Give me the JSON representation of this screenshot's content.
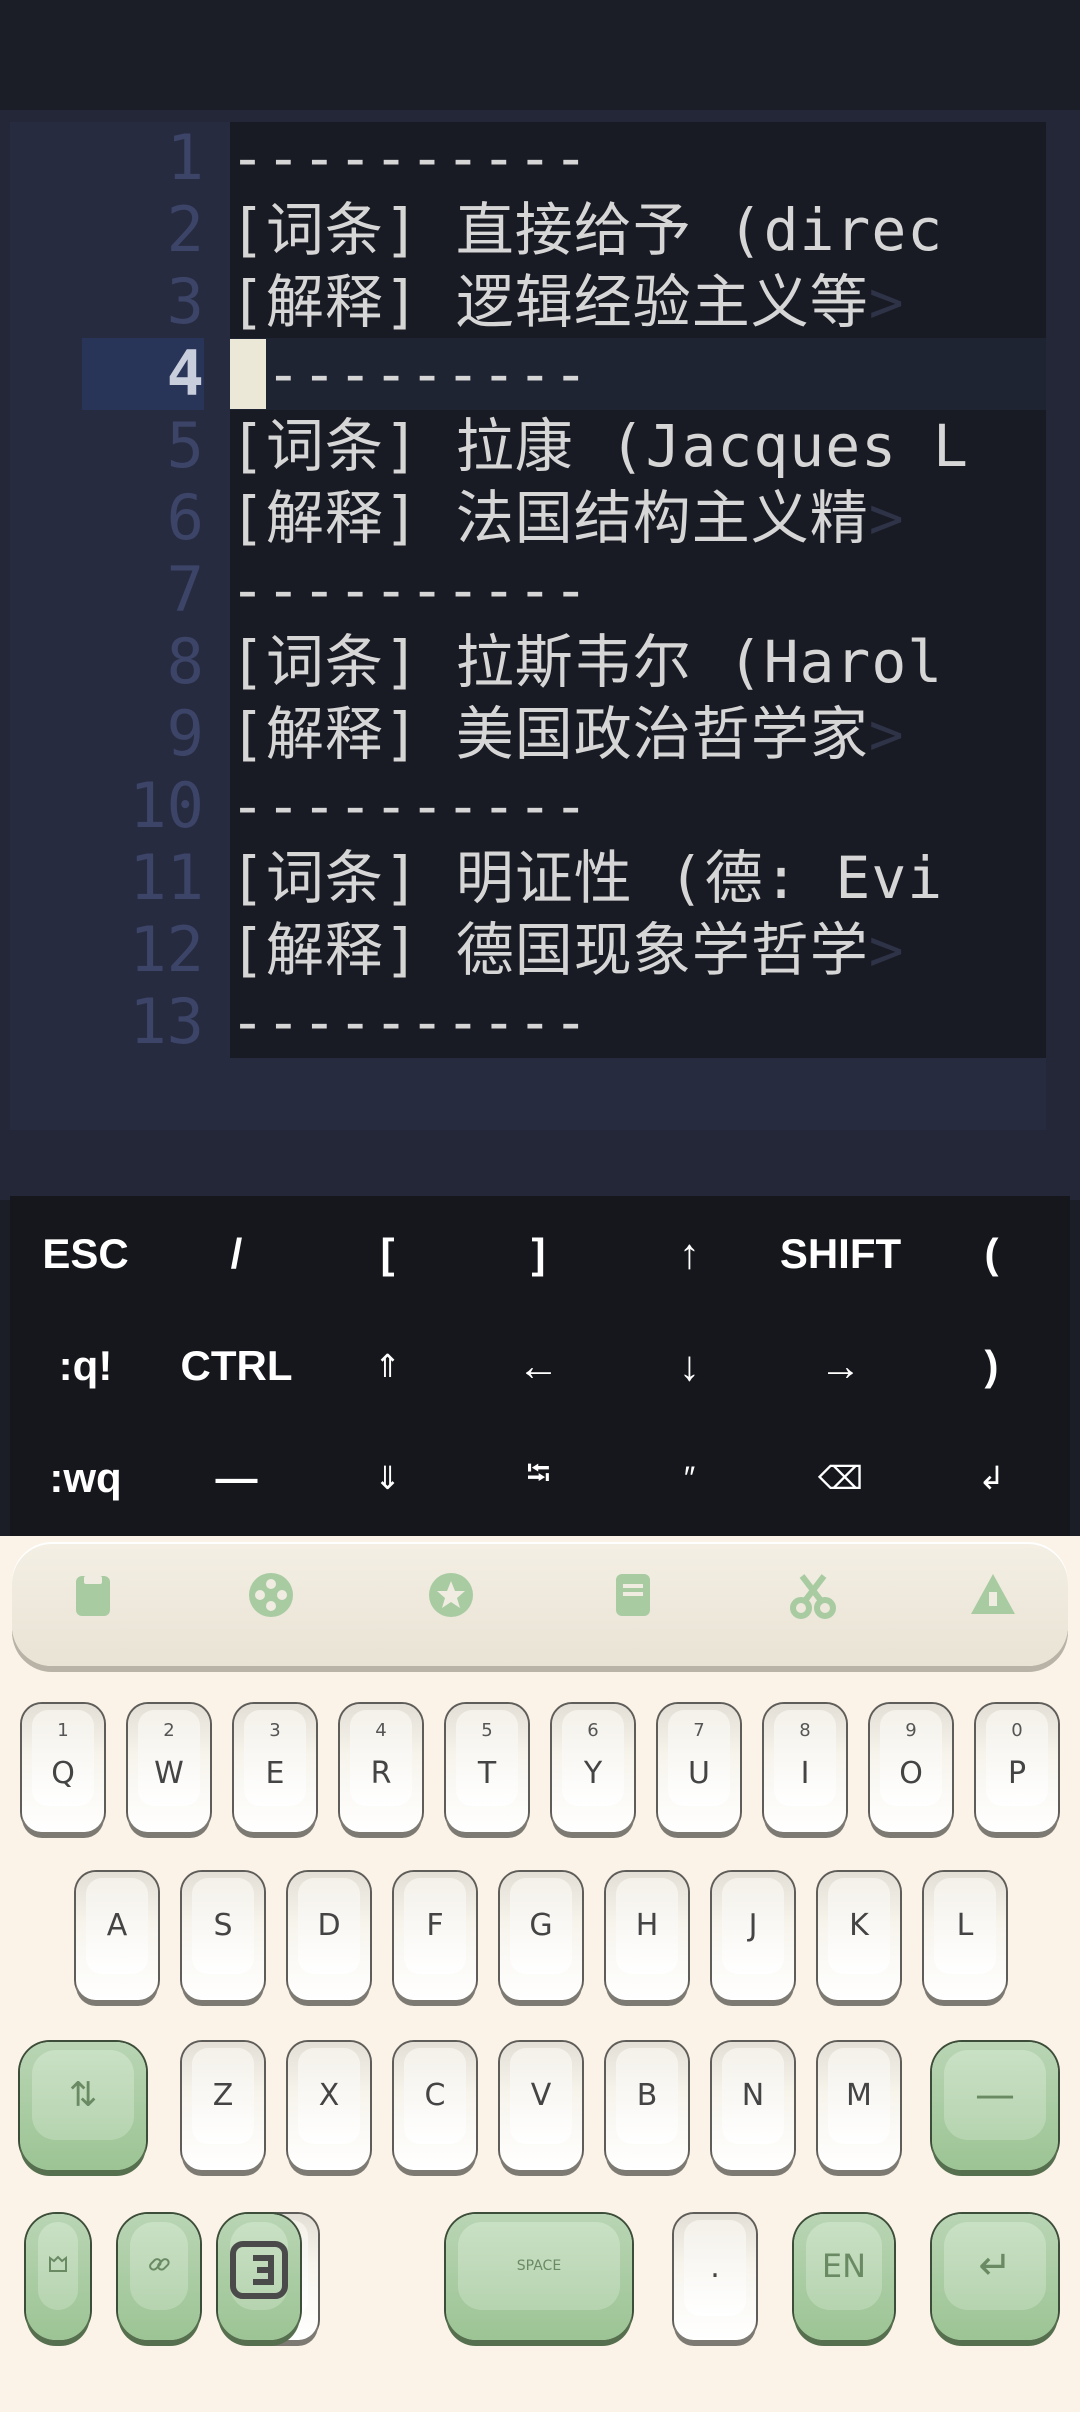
{
  "editor": {
    "line_numbers": [
      "1",
      "2",
      "3",
      "4",
      "5",
      "6",
      "7",
      "8",
      "9",
      "10",
      "11",
      "12",
      "13"
    ],
    "current_line": "4",
    "lines": [
      {
        "text": "----------",
        "more": ""
      },
      {
        "text": "[词条] 直接给予 (direc",
        "more": ""
      },
      {
        "text": "[解释] 逻辑经验主义等",
        "more": ">"
      },
      {
        "text": "----------",
        "more": ""
      },
      {
        "text": "[词条] 拉康 (Jacques L",
        "more": ""
      },
      {
        "text": "[解释] 法国结构主义精",
        "more": ">"
      },
      {
        "text": "----------",
        "more": ""
      },
      {
        "text": "[词条] 拉斯韦尔 (Harol",
        "more": ""
      },
      {
        "text": "[解释] 美国政治哲学家",
        "more": ">"
      },
      {
        "text": "----------",
        "more": ""
      },
      {
        "text": "[词条] 明证性 (德: Evi",
        "more": ""
      },
      {
        "text": "[解释] 德国现象学哲学",
        "more": ">"
      },
      {
        "text": "----------",
        "more": ""
      }
    ]
  },
  "extra_keys": {
    "row1": [
      "ESC",
      "/",
      "[",
      "]",
      "↑",
      "SHIFT",
      "("
    ],
    "row2": [
      ":q!",
      "CTRL",
      "⇑",
      "←",
      "↓",
      "→",
      ")"
    ],
    "row3": [
      ":wq",
      "—",
      "⇓",
      "⭾",
      "″",
      "⌫",
      "↲"
    ]
  },
  "keyboard": {
    "toolbar_icons": [
      "clipboard-icon",
      "gamepad-icon",
      "star-icon",
      "note-icon",
      "scissors-icon",
      "triangle-icon"
    ],
    "row1": [
      {
        "main": "Q",
        "sub": "1"
      },
      {
        "main": "W",
        "sub": "2"
      },
      {
        "main": "E",
        "sub": "3"
      },
      {
        "main": "R",
        "sub": "4"
      },
      {
        "main": "T",
        "sub": "5"
      },
      {
        "main": "Y",
        "sub": "6"
      },
      {
        "main": "U",
        "sub": "7"
      },
      {
        "main": "I",
        "sub": "8"
      },
      {
        "main": "O",
        "sub": "9"
      },
      {
        "main": "P",
        "sub": "0"
      }
    ],
    "row2": [
      "A",
      "S",
      "D",
      "F",
      "G",
      "H",
      "J",
      "K",
      "L"
    ],
    "row3": [
      "Z",
      "X",
      "C",
      "V",
      "B",
      "N",
      "M"
    ],
    "shift_label": "⇅",
    "backspace_label": "—",
    "comma_label": ",",
    "space_label": "SPACE",
    "period_label": ".",
    "lang_label": "EN",
    "enter_label": "↵",
    "accent_color": "#a9cba2",
    "key_color": "#f7f4ec",
    "background": "#fbf3e7"
  }
}
